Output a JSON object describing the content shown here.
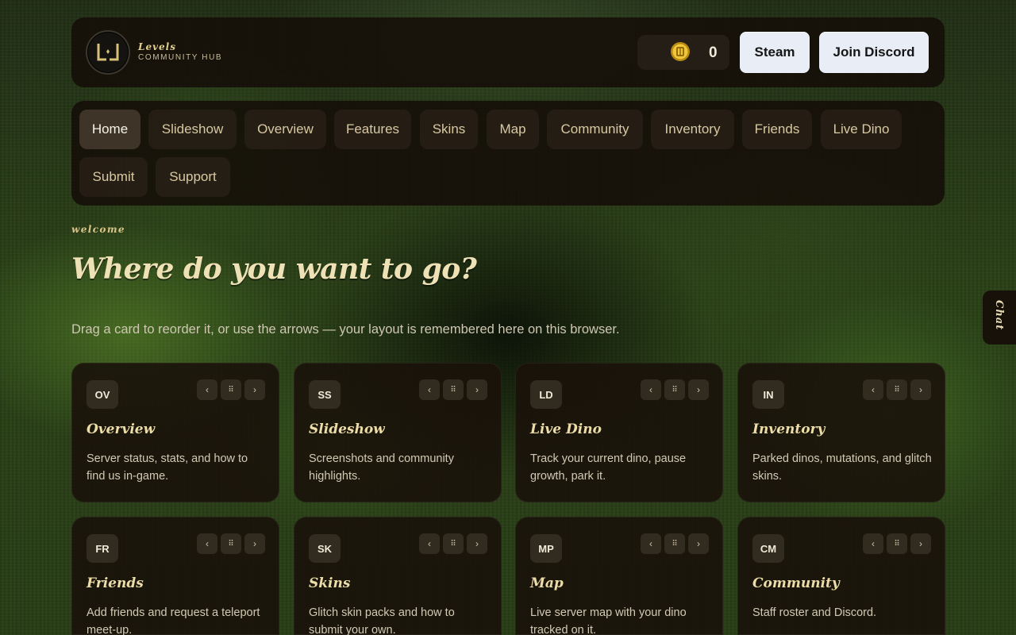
{
  "brand": {
    "name": "Levels",
    "subtitle": "COMMUNITY HUB",
    "logo_icon": "levels-logo-icon"
  },
  "header": {
    "coin_icon": "coin-icon",
    "coin_count": "0",
    "steam_label": "Steam",
    "discord_label": "Join Discord"
  },
  "nav": {
    "items": [
      {
        "label": "Home",
        "active": true
      },
      {
        "label": "Slideshow"
      },
      {
        "label": "Overview"
      },
      {
        "label": "Features"
      },
      {
        "label": "Skins"
      },
      {
        "label": "Map"
      },
      {
        "label": "Community"
      },
      {
        "label": "Inventory"
      },
      {
        "label": "Friends"
      },
      {
        "label": "Live Dino"
      },
      {
        "label": "Submit"
      },
      {
        "label": "Support"
      }
    ]
  },
  "welcome": {
    "eyebrow": "welcome",
    "headline": "Where do you want to go?",
    "subtext": "Drag a card to reorder it, or use the arrows — your layout is remembered here on this browser."
  },
  "cards": [
    {
      "abbr": "OV",
      "title": "Overview",
      "desc": "Server status, stats, and how to find us in-game."
    },
    {
      "abbr": "SS",
      "title": "Slideshow",
      "desc": "Screenshots and community highlights."
    },
    {
      "abbr": "LD",
      "title": "Live Dino",
      "desc": "Track your current dino, pause growth, park it."
    },
    {
      "abbr": "IN",
      "title": "Inventory",
      "desc": "Parked dinos, mutations, and glitch skins."
    },
    {
      "abbr": "FR",
      "title": "Friends",
      "desc": "Add friends and request a teleport meet-up."
    },
    {
      "abbr": "SK",
      "title": "Skins",
      "desc": "Glitch skin packs and how to submit your own."
    },
    {
      "abbr": "MP",
      "title": "Map",
      "desc": "Live server map with your dino tracked on it."
    },
    {
      "abbr": "CM",
      "title": "Community",
      "desc": "Staff roster and Discord."
    }
  ],
  "card_controls": {
    "prev_glyph": "‹",
    "drag_glyph": "⠿",
    "next_glyph": "›"
  },
  "chat_tab": {
    "label": "Chat"
  },
  "colors": {
    "accent_gold": "#e2cf8e",
    "panel_bg": "#140e08",
    "button_light": "#e8edf6"
  }
}
